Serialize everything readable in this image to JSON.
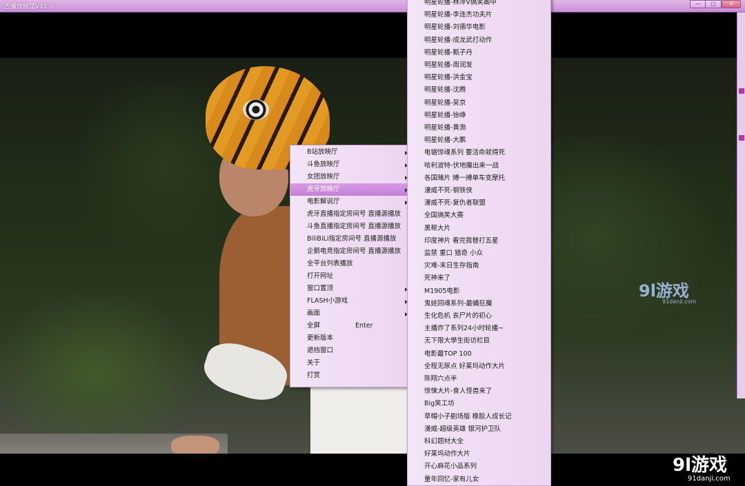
{
  "window": {
    "title": "吉播放映馆V11.0",
    "buttons": [
      "—",
      "□",
      "✕"
    ]
  },
  "main_menu": {
    "items": [
      {
        "label": "B站放映厅",
        "submenu": true
      },
      {
        "label": "斗鱼放映厅",
        "submenu": true
      },
      {
        "label": "女团放映厅",
        "submenu": true
      },
      {
        "label": "虎牙放映厅",
        "submenu": true,
        "highlighted": true
      },
      {
        "label": "电影解说厅",
        "submenu": true
      },
      {
        "label": "虎牙直播指定房间号  直播源播放",
        "submenu": false
      },
      {
        "label": "斗鱼直播指定房间号  直播源播放",
        "submenu": false
      },
      {
        "label": "BiliBiLi指定房间号     直播源播放",
        "submenu": false
      },
      {
        "label": "企鹅电竞指定房间号  直播源播放",
        "submenu": false
      },
      {
        "label": "全平台列表播放",
        "submenu": false
      },
      {
        "label": "打开网址",
        "submenu": false
      },
      {
        "label": "窗口置顶",
        "submenu": true
      },
      {
        "label": "FLASH小游戏",
        "submenu": true
      },
      {
        "label": "画面",
        "submenu": true
      },
      {
        "label": "全屏",
        "submenu": false,
        "shortcut": "Enter"
      },
      {
        "label": "更新版本",
        "submenu": false
      },
      {
        "label": "遮挡窗口",
        "submenu": false
      },
      {
        "label": "关于",
        "submenu": false
      },
      {
        "label": "打赏",
        "submenu": false
      }
    ]
  },
  "sub_menu": {
    "items": [
      "明星轮播-林萍V搞笑画中",
      "明星轮播-李连杰功夫片",
      "明星轮播-刘德华电影",
      "明星轮播-成龙武打动作",
      "明星轮播-甄子丹",
      "明星轮播-周润发",
      "明星轮播-洪金宝",
      "明星轮播-沈腾",
      "明星轮播-吴京",
      "明星轮播-徐峥",
      "明星轮播-黄渤",
      "明星轮播-大鹏",
      "电锯惊魂系列 要活命就得死",
      "哈利波特-伏地魔出来一战",
      "各国赌片 搏一搏单车变摩托",
      "漫威不死-钢铁侠",
      "漫威不死-复仇者联盟",
      "全国搞笑大赛",
      "黑帮大片",
      "印度神片 看完我替打五星",
      "监禁 重口 猎奇 小众",
      "灾难-末日生存指南",
      "死神来了",
      "M1905电影",
      "鬼娃回魂系列-最蛹狂魔",
      "生化危机 丧尸片的初心",
      "主播炸了系列24小时轮播~",
      "无下限大學生街访栏目",
      "电影最TOP 100",
      "全程无尿点 好莱坞动作大片",
      "陈翔六点半",
      "惊悚大片-食人怪兽来了",
      "Big笑工坊",
      "草帽小子剧场版  橡胶人成长记",
      "漫威-超级英雄 银河护卫队",
      "科幻题材大全",
      "好莱坞动作大片",
      "开心麻花小品系列",
      "童年回忆-家有儿女"
    ]
  },
  "watermarks": {
    "mid_logo": "9l游戏",
    "mid_url": "91danji.com",
    "bottom_logo": "9l游戏",
    "bottom_url": "91danji.com"
  },
  "colors": {
    "menu_bg": "#f0ddf3",
    "menu_highlight": "#cf8ee0",
    "titlebar": "#d5a2de"
  }
}
